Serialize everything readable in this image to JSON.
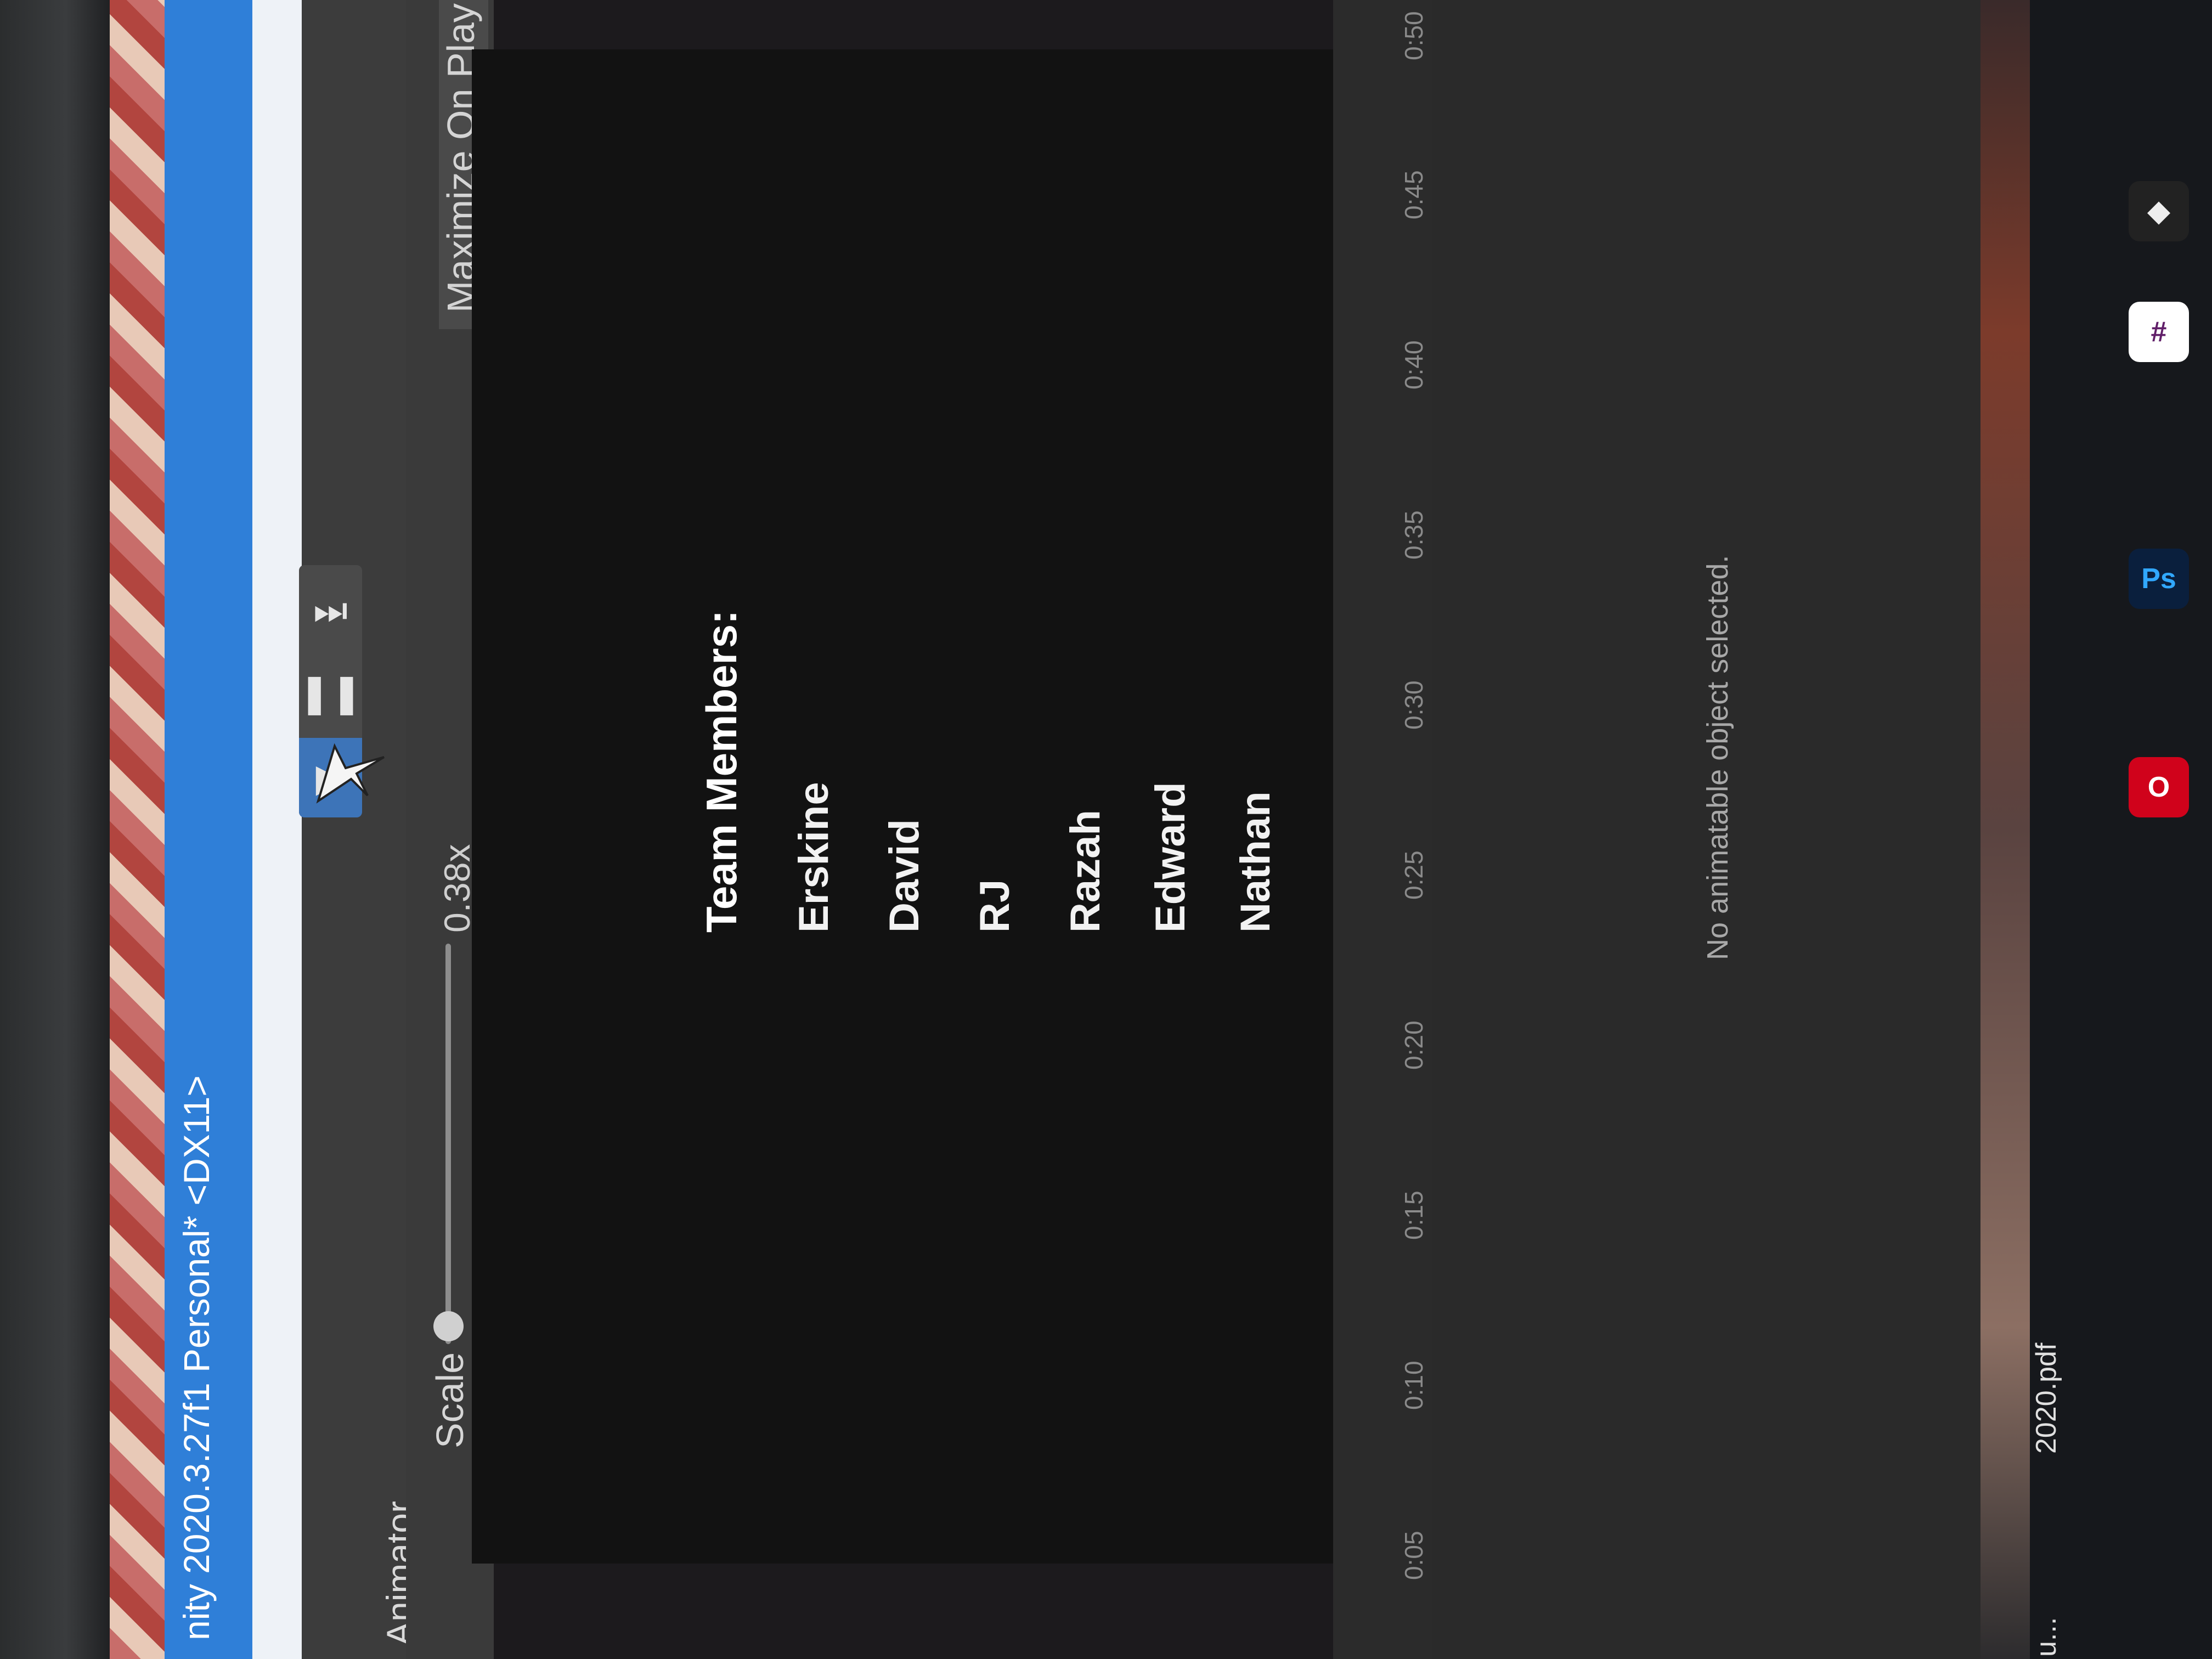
{
  "window": {
    "title": "nity 2020.3.27f1 Personal* <DX11>"
  },
  "toolbar": {
    "play_icon": "play-icon",
    "pause_icon": "pause-icon",
    "step_icon": "step-icon"
  },
  "animator": {
    "tab_label": "Animator"
  },
  "game_view": {
    "scale_label": "Scale",
    "scale_value": "0.38x",
    "maximize_label": "Maximize On Play",
    "heading": "Team Members:",
    "members": [
      "Erskine",
      "David",
      "RJ",
      "Razah",
      "Edward",
      "Nathan"
    ]
  },
  "timeline": {
    "ticks": [
      "0:05",
      "0:10",
      "0:15",
      "0:20",
      "0:25",
      "0:30",
      "0:35",
      "0:40",
      "0:45",
      "0:50"
    ]
  },
  "inspector": {
    "empty_message": "No animatable object selected."
  },
  "taskbar": {
    "file_label": "2020.pdf",
    "file_label_2": "u...",
    "icons": [
      "photoshop-icon",
      "opera-icon",
      "slack-icon",
      "unity-icon"
    ]
  },
  "colors": {
    "title_bar": "#2f7fd8",
    "game_background": "#121212",
    "editor_dark": "#3a3a3a"
  }
}
